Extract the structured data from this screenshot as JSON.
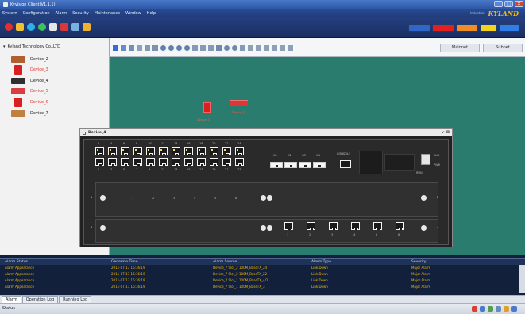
{
  "window": {
    "title": "Kyvision Client(V1.1.1)",
    "controls": [
      "_",
      "□",
      "×"
    ]
  },
  "menu": {
    "items": [
      "System",
      "Configuration",
      "Alarm",
      "Security",
      "Maintenance",
      "Window",
      "Help"
    ],
    "brand_sub": "Industrial",
    "brand_logo": "KYLAND"
  },
  "toolbar": {
    "icons": [
      "exit-icon",
      "lock-icon",
      "topology-icon",
      "discover-icon",
      "list-icon",
      "device-icon",
      "report-icon",
      "user-icon"
    ],
    "right_buttons": [
      {
        "name": "status-blue-button",
        "color": "#2f66c8"
      },
      {
        "name": "alarm-critical-button",
        "color": "#e22020"
      },
      {
        "name": "alarm-major-button",
        "color": "#f08c24"
      },
      {
        "name": "alarm-minor-button",
        "color": "#f2d21c"
      },
      {
        "name": "alarm-info-button",
        "color": "#2f7ee8"
      }
    ]
  },
  "tree": {
    "company": "Kyland Technology Co.,LTD",
    "devices": [
      {
        "label": "Device_2",
        "state": "normal",
        "color": "#b06030"
      },
      {
        "label": "Device_3",
        "state": "alarm",
        "color": "#d82020"
      },
      {
        "label": "Device_4",
        "state": "normal",
        "color": "#303030"
      },
      {
        "label": "Device_5",
        "state": "alarm",
        "color": "#d84040"
      },
      {
        "label": "Device_6",
        "state": "alarm",
        "color": "#d82020"
      },
      {
        "label": "Device_7",
        "state": "normal",
        "color": "#c08040"
      }
    ]
  },
  "canvas_toolbar": {
    "buttons": [
      "Mainnet",
      "Subnet"
    ]
  },
  "canvas": {
    "background": "#2a7c6e",
    "devices": [
      {
        "label": "Device_3"
      },
      {
        "label": "Device_5"
      }
    ]
  },
  "device_window": {
    "title": "Device_4",
    "controls": "↙ ⊠",
    "top_numbers": [
      "2",
      "4",
      "6",
      "8",
      "10",
      "12",
      "14",
      "16",
      "18",
      "20",
      "22",
      "24"
    ],
    "bottom_numbers": [
      "1",
      "3",
      "5",
      "7",
      "9",
      "11",
      "13",
      "15",
      "17",
      "19",
      "21",
      "23"
    ],
    "sfp_labels": [
      "G1",
      "G2",
      "G3",
      "G4"
    ],
    "console_label": "CONSOLE",
    "right_labels": [
      "ALM",
      "PWR",
      "RUN"
    ],
    "module_labels": [
      "1",
      "2",
      "3",
      "4"
    ],
    "mod1_ports": [
      "1",
      "2",
      "3",
      "4",
      "5",
      "6"
    ],
    "mod3_ports": [
      "1",
      "2",
      "3",
      "4",
      "5",
      "6"
    ]
  },
  "alarms": {
    "columns": [
      "Alarm Status",
      "Generate Time",
      "Alarm Source",
      "Alarm Type",
      "Severity"
    ],
    "rows": [
      [
        "Alarm Appearance",
        "2011-07-13 16:36:19",
        "Device_7 Slot_2 100M_BaseTX_24",
        "Link Down",
        "Major Alarm"
      ],
      [
        "Alarm Appearance",
        "2011-07-13 16:36:19",
        "Device_7 Slot_2 100M_BaseTX_22",
        "Link Down",
        "Major Alarm"
      ],
      [
        "Alarm Appearance",
        "2011-07-13 16:36:19",
        "Device_7 Slot_1 100M_BaseTX_4/1",
        "Link Down",
        "Major Alarm"
      ],
      [
        "Alarm Appearance",
        "2011-07-13 16:36:19",
        "Device_7 Slot_1 100M_BaseTX_3",
        "Link Down",
        "Major Alarm"
      ]
    ]
  },
  "tabs": [
    "Alarm",
    "Operation Log",
    "Running Log"
  ],
  "status": {
    "label": "Status"
  }
}
